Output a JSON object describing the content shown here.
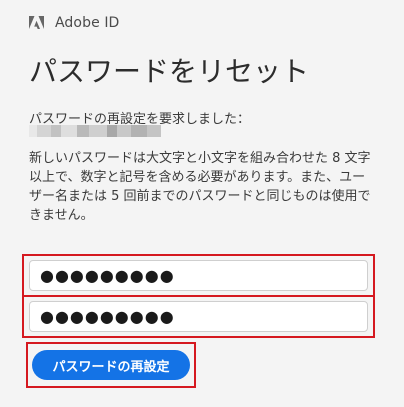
{
  "header": {
    "logo_icon": "adobe-logo-icon",
    "brand": "Adobe ID"
  },
  "title": "パスワードをリセット",
  "request_text": "パスワードの再設定を要求しました：",
  "description": "新しいパスワードは大文字と小文字を組み合わせた 8 文字以上で、数字と記号を含める必要があります。また、ユーザー名または 5 回前までのパスワードと同じものは使用できません。",
  "form": {
    "new_password_value": "●●●●●●●●●",
    "confirm_password_value": "●●●●●●●●●"
  },
  "submit_label": "パスワードの再設定",
  "colors": {
    "accent": "#1473e6",
    "highlight_border": "#d51920",
    "background": "#f4f4f4"
  }
}
